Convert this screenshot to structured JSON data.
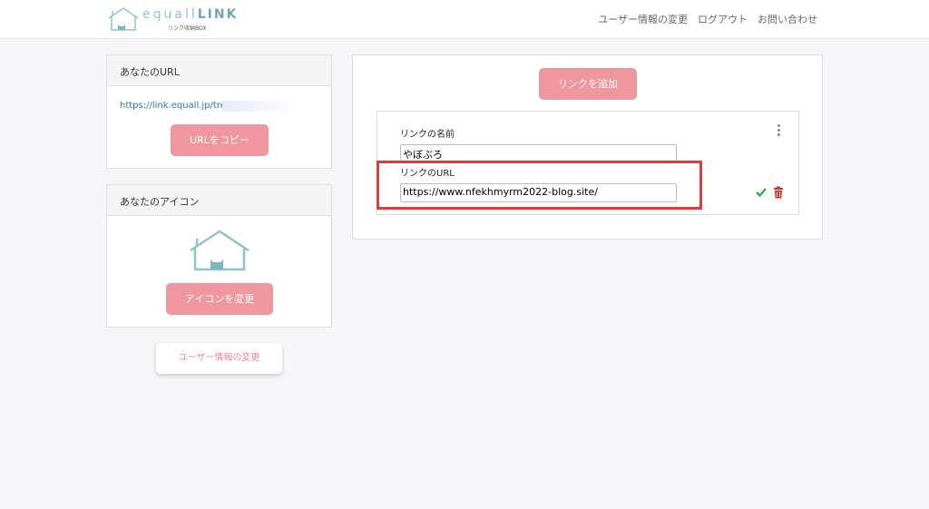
{
  "header": {
    "logo_text_light": "equall",
    "logo_text_bold": "LINK",
    "logo_sub": "リンク収納BOX",
    "nav": [
      "ユーザー情報の変更",
      "ログアウト",
      "お問い合わせ"
    ]
  },
  "url_card": {
    "title": "あなたのURL",
    "url": "https://link.equall.jp/tree/",
    "copy_label": "URLをコピー"
  },
  "icon_card": {
    "title": "あなたのアイコン",
    "change_label": "アイコンを変更"
  },
  "user_info_label": "ユーザー情報の変更",
  "main": {
    "add_label": "リンクを追加",
    "link": {
      "name_label": "リンクの名前",
      "name_value": "やぼぶろ",
      "url_label": "リンクのURL",
      "url_value": "https://www.nfekhmyrm2022-blog.site/"
    }
  },
  "colors": {
    "accent": "#f0969f",
    "logo": "#8fc5c9",
    "highlight": "#e63a3a",
    "save": "#2aa84a",
    "delete": "#d9302c"
  },
  "icons": [
    "house-logo-icon",
    "kebab-menu-icon",
    "check-icon",
    "trash-icon"
  ]
}
